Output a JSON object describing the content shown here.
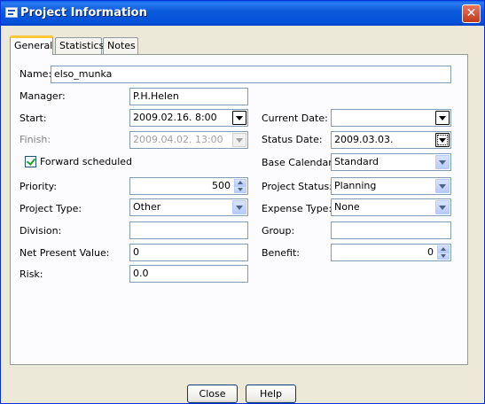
{
  "window": {
    "title": "Project Information",
    "close_glyph": "✕"
  },
  "tabs": [
    {
      "label": "General",
      "active": true
    },
    {
      "label": "Statistics",
      "active": false
    },
    {
      "label": "Notes",
      "active": false
    }
  ],
  "form": {
    "name": {
      "label": "Name:",
      "value": "elso_munka"
    },
    "manager": {
      "label": "Manager:",
      "value": "P.H.Helen"
    },
    "start": {
      "label": "Start:",
      "value": "2009.02.16. 8:00"
    },
    "finish": {
      "label": "Finish:",
      "value": "2009.04.02. 13:00",
      "enabled": false
    },
    "forward_scheduled": {
      "label": "Forward scheduled",
      "checked": true
    },
    "priority": {
      "label": "Priority:",
      "value": "500"
    },
    "project_type": {
      "label": "Project Type:",
      "value": "Other"
    },
    "division": {
      "label": "Division:",
      "value": ""
    },
    "net_present_value": {
      "label": "Net Present Value:",
      "value": "0"
    },
    "risk": {
      "label": "Risk:",
      "value": "0.0"
    },
    "current_date": {
      "label": "Current Date:",
      "value": ""
    },
    "status_date": {
      "label": "Status Date:",
      "value": "2009.03.03."
    },
    "base_calendar": {
      "label": "Base Calendar:",
      "value": "Standard"
    },
    "project_status": {
      "label": "Project Status:",
      "value": "Planning"
    },
    "expense_type": {
      "label": "Expense Type:",
      "value": "None"
    },
    "group": {
      "label": "Group:",
      "value": ""
    },
    "benefit": {
      "label": "Benefit:",
      "value": "0"
    }
  },
  "buttons": {
    "close": "Close",
    "help": "Help"
  },
  "colors": {
    "titlebar": "#0a5ee8",
    "dialog_bg": "#ece9d8",
    "tab_highlight": "#ffc83c",
    "close_button": "#c0391b"
  },
  "icons": {
    "app": "project-app-icon",
    "close": "close-icon",
    "dropdown": "chevron-down-icon",
    "spinner": "spinner-icon",
    "checkbox": "checkmark-icon"
  }
}
